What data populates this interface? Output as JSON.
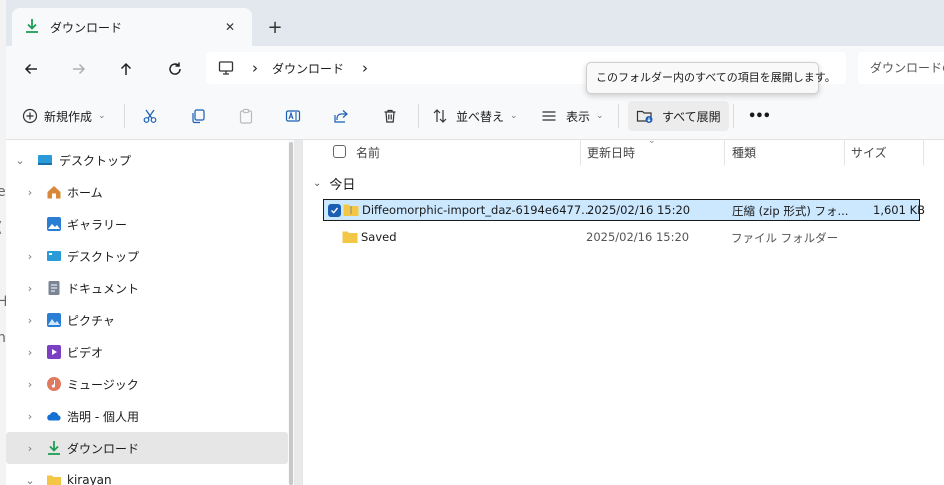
{
  "tab": {
    "title": "ダウンロード",
    "close": "✕",
    "new_tab": "+"
  },
  "address": {
    "separator": "›",
    "crumb": "ダウンロード",
    "search_placeholder": "ダウンロードの検索"
  },
  "tooltip": "このフォルダー内のすべての項目を展開します。",
  "toolbar": {
    "new_label": "新規作成",
    "sort_label": "並べ替え",
    "view_label": "表示",
    "extract_all_label": "すべて展開",
    "more_label": "•••"
  },
  "nav": {
    "items": [
      {
        "label": "デスクトップ",
        "expander": "⌄",
        "icon": "desktop-icon"
      },
      {
        "label": "ホーム",
        "expander": "›",
        "icon": "home-icon"
      },
      {
        "label": "ギャラリー",
        "expander": "",
        "icon": "gallery-icon"
      },
      {
        "label": "デスクトップ",
        "expander": "›",
        "icon": "desktop-icon"
      },
      {
        "label": "ドキュメント",
        "expander": "›",
        "icon": "document-icon"
      },
      {
        "label": "ピクチャ",
        "expander": "›",
        "icon": "picture-icon"
      },
      {
        "label": "ビデオ",
        "expander": "›",
        "icon": "video-icon"
      },
      {
        "label": "ミュージック",
        "expander": "›",
        "icon": "music-icon"
      },
      {
        "label": "浩明 - 個人用",
        "expander": "›",
        "icon": "onedrive-icon"
      },
      {
        "label": "ダウンロード",
        "expander": "›",
        "icon": "download-icon"
      },
      {
        "label": "kirayan",
        "expander": "⌄",
        "icon": "folder-icon"
      }
    ]
  },
  "columns": {
    "name": "名前",
    "date": "更新日時",
    "type": "種類",
    "size": "サイズ"
  },
  "group": {
    "label": "今日"
  },
  "files": [
    {
      "name": "Diffeomorphic-import_daz-6194e6477...",
      "date": "2025/02/16 15:20",
      "type": "圧縮 (zip 形式) フォ...",
      "size": "1,601 KB"
    },
    {
      "name": "Saved",
      "date": "2025/02/16 15:20",
      "type": "ファイル フォルダー",
      "size": ""
    }
  ],
  "colors": {
    "accent": "#1a5fb4",
    "download_green": "#1f9d55",
    "folder": "#f3c645",
    "selected_row": "#cce8ff"
  }
}
